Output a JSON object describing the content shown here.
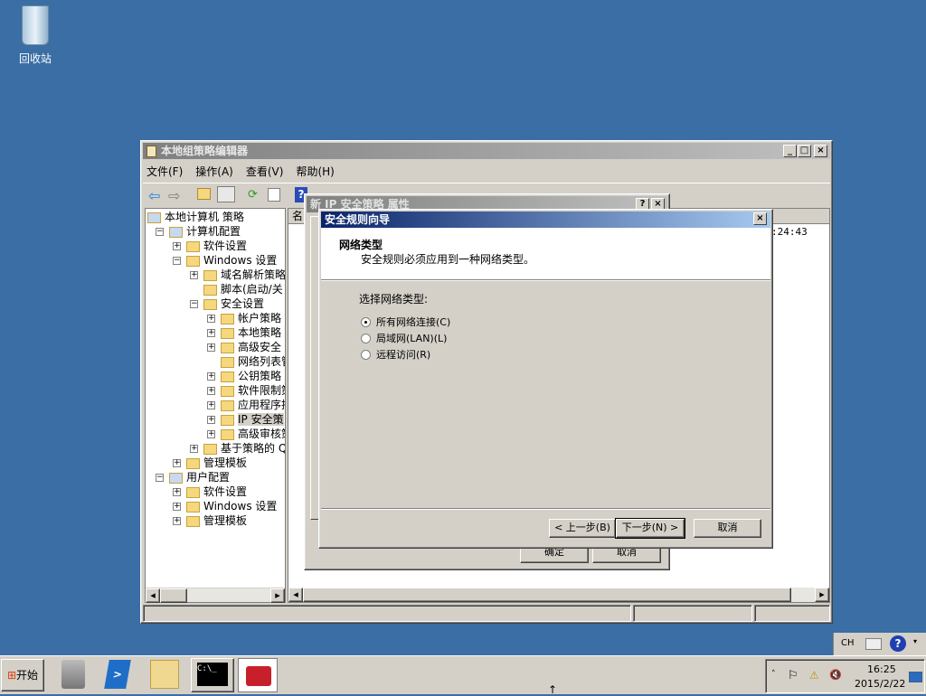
{
  "desktop": {
    "recycle_bin": "回收站"
  },
  "main_window": {
    "title": "本地组策略编辑器",
    "menu": [
      "文件(F)",
      "操作(A)",
      "查看(V)",
      "帮助(H)"
    ],
    "tree": [
      {
        "label": "本地计算机 策略",
        "level": 0,
        "exp": ""
      },
      {
        "label": "计算机配置",
        "level": 1,
        "exp": "-"
      },
      {
        "label": "软件设置",
        "level": 2,
        "exp": "+"
      },
      {
        "label": "Windows 设置",
        "level": 2,
        "exp": "-"
      },
      {
        "label": "域名解析策略",
        "level": 3,
        "exp": "+"
      },
      {
        "label": "脚本(启动/关",
        "level": 3,
        "exp": ""
      },
      {
        "label": "安全设置",
        "level": 3,
        "exp": "-"
      },
      {
        "label": "帐户策略",
        "level": 4,
        "exp": "+"
      },
      {
        "label": "本地策略",
        "level": 4,
        "exp": "+"
      },
      {
        "label": "高级安全",
        "level": 4,
        "exp": "+"
      },
      {
        "label": "网络列表管",
        "level": 4,
        "exp": ""
      },
      {
        "label": "公钥策略",
        "level": 4,
        "exp": "+"
      },
      {
        "label": "软件限制策",
        "level": 4,
        "exp": "+"
      },
      {
        "label": "应用程序控",
        "level": 4,
        "exp": "+"
      },
      {
        "label": "IP 安全策",
        "level": 4,
        "exp": "+",
        "selected": true
      },
      {
        "label": "高级审核策",
        "level": 4,
        "exp": "+"
      },
      {
        "label": "基于策略的 Q",
        "level": 3,
        "exp": "+"
      },
      {
        "label": "管理模板",
        "level": 2,
        "exp": "+"
      },
      {
        "label": "用户配置",
        "level": 1,
        "exp": "-"
      },
      {
        "label": "软件设置",
        "level": 2,
        "exp": "+"
      },
      {
        "label": "Windows 设置",
        "level": 2,
        "exp": "+"
      },
      {
        "label": "管理模板",
        "level": 2,
        "exp": "+"
      }
    ],
    "list_header": "名",
    "list_time": ":24:43"
  },
  "properties_dialog": {
    "title": "新 IP 安全策略 属性",
    "ok": "确定",
    "cancel": "取消"
  },
  "wizard": {
    "title": "安全规则向导",
    "header_title": "网络类型",
    "header_subtitle": "安全规则必须应用到一种网络类型。",
    "prompt": "选择网络类型:",
    "options": [
      {
        "label": "所有网络连接(C)",
        "selected": true
      },
      {
        "label": "局域网(LAN)(L)",
        "selected": false
      },
      {
        "label": "远程访问(R)",
        "selected": false
      }
    ],
    "back": "< 上一步(B)",
    "next": "下一步(N) >",
    "cancel": "取消"
  },
  "langbar": {
    "lang": "CH"
  },
  "taskbar": {
    "start": "开始",
    "time": "16:25",
    "date": "2015/2/22"
  }
}
